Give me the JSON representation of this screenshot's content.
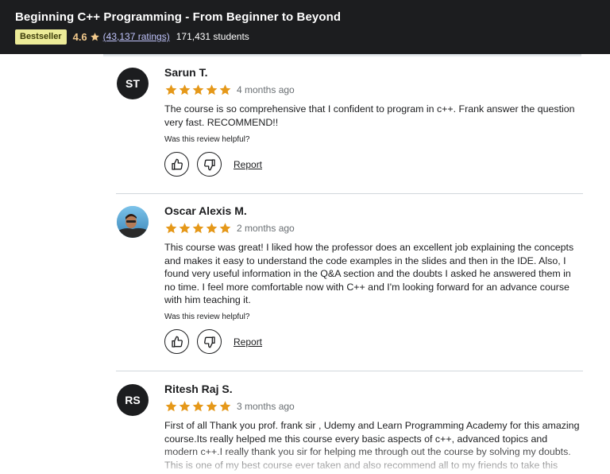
{
  "header": {
    "course_title": "Beginning C++ Programming - From Beginner to Beyond",
    "badge": "Bestseller",
    "rating": "4.6",
    "ratings_count": "(43,137 ratings)",
    "students": "171,431 students",
    "accent_color": "#f3ca8c",
    "badge_color": "#eceb98",
    "link_color": "#c0c4fc"
  },
  "reviews": [
    {
      "initials": "ST",
      "avatar_type": "initials",
      "name": "Sarun T.",
      "stars": 5,
      "date": "4 months ago",
      "text": "The course is so comprehensive that I confident to program in c++. Frank answer the question very fast. RECOMMEND!!",
      "helpful_label": "Was this review helpful?",
      "report_label": "Report"
    },
    {
      "initials": "",
      "avatar_type": "photo",
      "name": "Oscar Alexis M.",
      "stars": 5,
      "date": "2 months ago",
      "text": "This course was great! I liked how the professor does an excellent job explaining the concepts and makes it easy to understand the code examples in the slides and then in the IDE. Also, I found very useful information in the Q&A section and the doubts I asked he answered them in no time. I feel more comfortable now with C++ and I'm looking forward for an advance course with him teaching it.",
      "helpful_label": "Was this review helpful?",
      "report_label": "Report"
    },
    {
      "initials": "RS",
      "avatar_type": "initials",
      "name": "Ritesh Raj S.",
      "stars": 5,
      "date": "3 months ago",
      "text": "First of all Thank you prof. frank sir , Udemy and Learn Programming Academy for this amazing course.Its really helped me this course every basic aspects of c++, advanced topics and modern c++.I really thank you sir for helping me through out the course by solving my doubts. This is one of my best course ever taken and also recommend all to my friends to take this course",
      "helpful_label": "",
      "report_label": ""
    }
  ],
  "icons": {
    "star": "star-icon",
    "thumbs_up": "thumbs-up-icon",
    "thumbs_down": "thumbs-down-icon"
  },
  "colors": {
    "star_color": "#e59819",
    "text_color": "#1c1d1f",
    "muted_text": "#6a6f73",
    "divider": "#d1d7dc"
  }
}
